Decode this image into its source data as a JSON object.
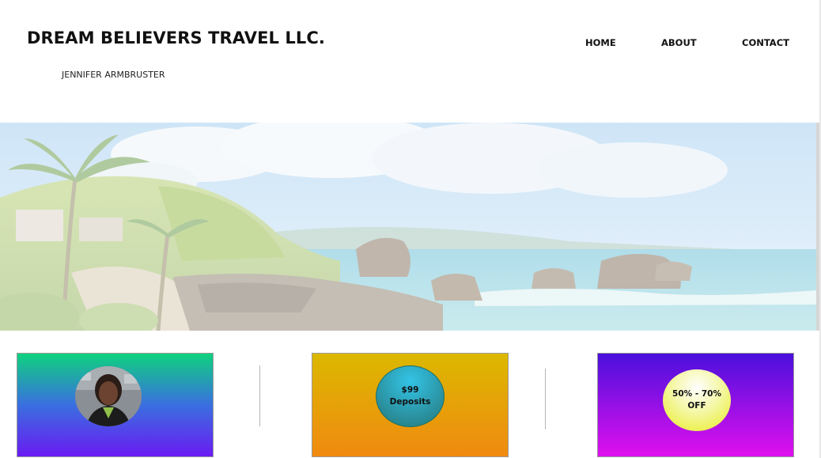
{
  "header": {
    "title": "DREAM BELIEVERS TRAVEL LLC.",
    "tagline": "JENNIFER ARMBRUSTER"
  },
  "nav": {
    "items": [
      {
        "label": "HOME"
      },
      {
        "label": "ABOUT"
      },
      {
        "label": "CONTACT"
      }
    ]
  },
  "hero": {
    "image": "tropical-coastline-banner"
  },
  "cards": [
    {
      "kind": "portrait-photo",
      "colors": [
        "#0ed27e",
        "#6a1bf2"
      ]
    },
    {
      "kind": "badge",
      "badge_text": "$99\nDeposits",
      "colors": [
        "#dcb800",
        "#f08a10"
      ],
      "badge_color": "#2a8d9a"
    },
    {
      "kind": "badge",
      "badge_text": "50% - 70%\nOFF",
      "colors": [
        "#4a10dc",
        "#e010ee"
      ],
      "badge_color": "#e8ec1e"
    }
  ]
}
